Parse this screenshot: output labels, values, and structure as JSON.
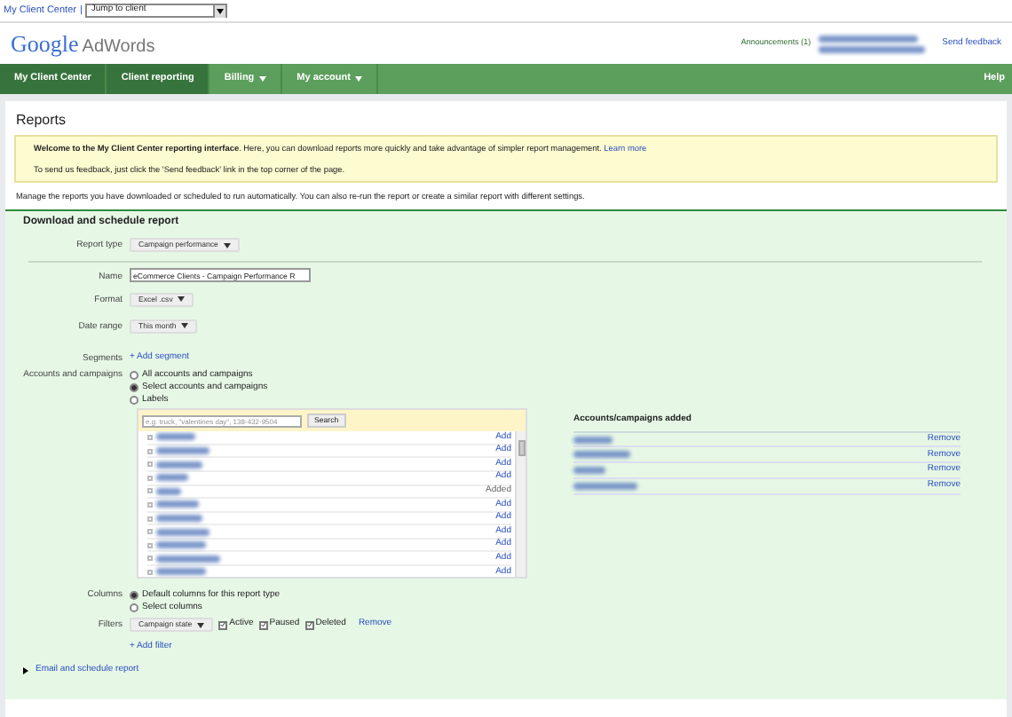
{
  "top_bar": {
    "link": "My Client Center",
    "separator": "|",
    "jump_select": "Jump to client"
  },
  "header": {
    "logo_google": "Google",
    "logo_product": "AdWords",
    "announcements": "Announcements (1)",
    "send_feedback": "Send feedback"
  },
  "nav": {
    "items": [
      {
        "label": "My Client Center",
        "selected": true,
        "dropdown": false
      },
      {
        "label": "Client reporting",
        "selected": true,
        "dropdown": false
      },
      {
        "label": "Billing",
        "selected": false,
        "dropdown": true
      },
      {
        "label": "My account",
        "selected": false,
        "dropdown": true
      }
    ],
    "help": "Help"
  },
  "page_title": "Reports",
  "notice": {
    "lines": [
      "**Welcome to the My Client Center reporting interface**. Here, you can download reports more quickly and take advantage of simpler report management.",
      "To send us feedback, just click the 'Send feedback' link in the top corner of the page."
    ],
    "link": "Learn more"
  },
  "intro": "Manage the reports you have downloaded or scheduled to run automatically. You can also re-run the report or create a similar report with different settings.",
  "section_title": "Download and schedule report",
  "report_type": {
    "label": "Report type",
    "value": "Campaign performance"
  },
  "name": {
    "label": "Name",
    "value": "eCommerce Clients - Campaign Performance R"
  },
  "format": {
    "label": "Format",
    "value": "Excel .csv"
  },
  "date_range": {
    "label": "Date range",
    "value": "This month"
  },
  "segments": {
    "label": "Segments",
    "link": "+ Add segment"
  },
  "accounts": {
    "label": "Accounts and campaigns",
    "options": [
      {
        "label": "All accounts and campaigns",
        "selected": false
      },
      {
        "label": "Select accounts and campaigns",
        "selected": true
      },
      {
        "label": "Labels",
        "selected": false
      }
    ],
    "search_placeholder": "e.g. truck, \"valentines day\", 138-432-9504",
    "search_button": "Search",
    "rows": [
      {
        "action": "Add",
        "added": false
      },
      {
        "action": "Add",
        "added": false
      },
      {
        "action": "Add",
        "added": false
      },
      {
        "action": "Add",
        "added": false
      },
      {
        "action": "Added",
        "added": true
      },
      {
        "action": "Add",
        "added": false
      },
      {
        "action": "Add",
        "added": false
      },
      {
        "action": "Add",
        "added": false
      },
      {
        "action": "Add",
        "added": false
      },
      {
        "action": "Add",
        "added": false
      },
      {
        "action": "Add",
        "added": false
      }
    ],
    "added_title": "Accounts/campaigns added",
    "added_rows": [
      {
        "action": "Remove"
      },
      {
        "action": "Remove"
      },
      {
        "action": "Remove"
      },
      {
        "action": "Remove"
      }
    ]
  },
  "columns": {
    "label": "Columns",
    "options": [
      {
        "label": "Default columns for this report type",
        "selected": true
      },
      {
        "label": "Select columns",
        "selected": false
      }
    ]
  },
  "filters": {
    "label": "Filters",
    "select": "Campaign state",
    "checkboxes": [
      {
        "label": "Active",
        "checked": true
      },
      {
        "label": "Paused",
        "checked": true
      },
      {
        "label": "Deleted",
        "checked": true
      }
    ],
    "remove": "Remove",
    "add": "+ Add filter"
  },
  "email_link": "Email and schedule report"
}
